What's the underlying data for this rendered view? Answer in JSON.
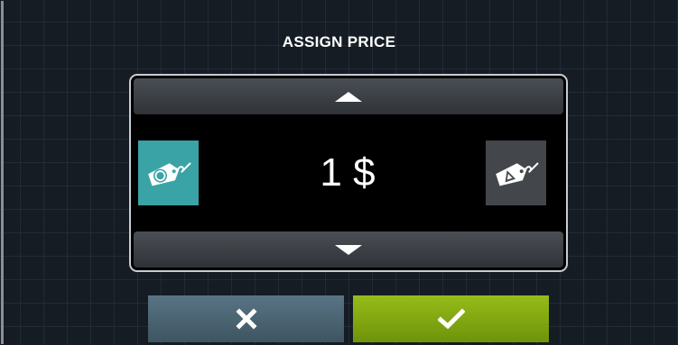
{
  "dialog": {
    "title": "ASSIGN PRICE"
  },
  "price": {
    "value": "1 $"
  },
  "icons": {
    "up": "triangle-up-icon",
    "down": "triangle-down-icon",
    "tag_coin": "price-tag-coin-icon",
    "tag_delta": "price-tag-delta-icon",
    "cancel": "x-icon",
    "confirm": "checkmark-icon"
  },
  "colors": {
    "background": "#151c24",
    "tag_coin_bg": "#3aa3a6",
    "tag_delta_bg": "#43474c",
    "cancel_bg": "#4a6573",
    "confirm_bg": "#84a912"
  }
}
